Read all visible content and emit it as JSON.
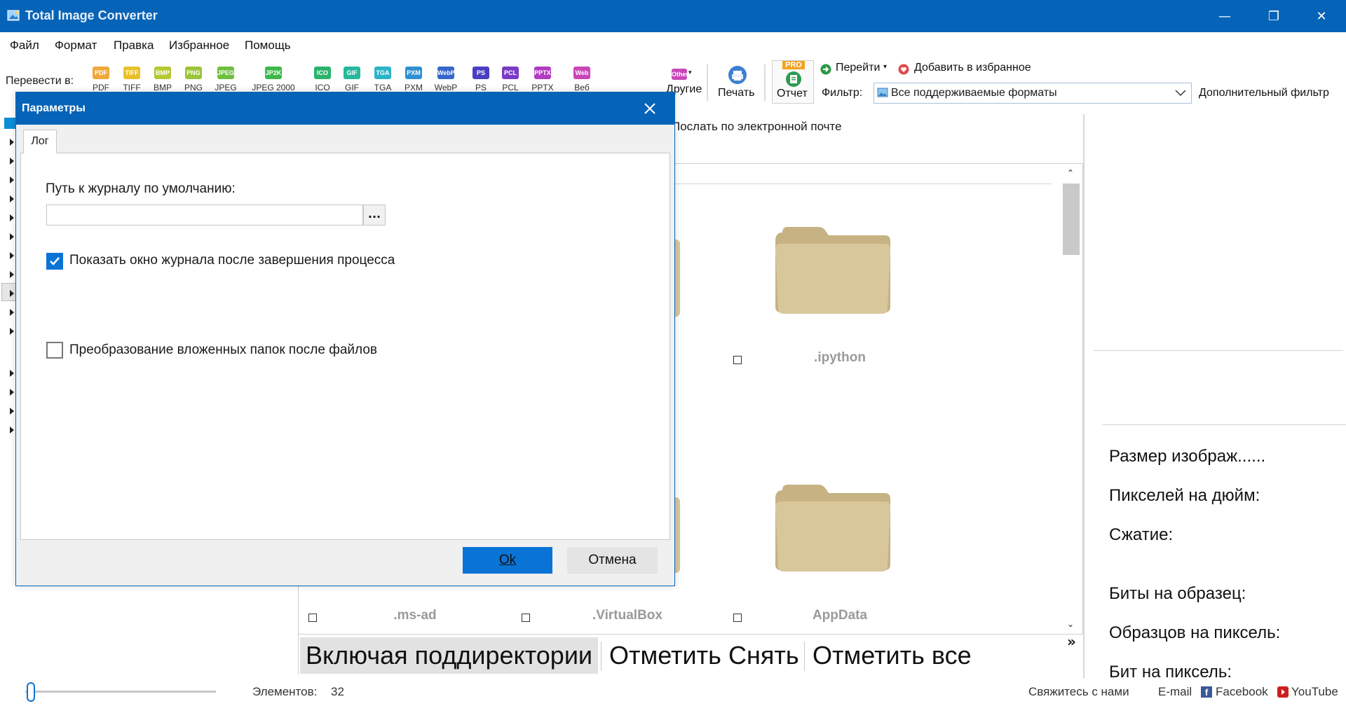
{
  "window": {
    "title": "Total Image Converter",
    "minimize_glyph": "—",
    "restore_glyph": "❐",
    "close_glyph": "✕"
  },
  "menu": [
    "Файл",
    "Формат",
    "Правка",
    "Избранное",
    "Помощь"
  ],
  "toolbar": {
    "convert_label": "Перевести в:",
    "formats": [
      {
        "icon": "PDF",
        "label": "PDF",
        "color": "#f1a83a"
      },
      {
        "icon": "TIFF",
        "label": "TIFF",
        "color": "#e8c02a"
      },
      {
        "icon": "BMP",
        "label": "BMP",
        "color": "#b5c832"
      },
      {
        "icon": "PNG",
        "label": "PNG",
        "color": "#9cc43a"
      },
      {
        "icon": "JPEG",
        "label": "JPEG",
        "color": "#6fbf3f"
      },
      {
        "icon": "JP2K",
        "label": "JPEG 2000",
        "color": "#3fb84a"
      },
      {
        "icon": "ICO",
        "label": "ICO",
        "color": "#2bb36c"
      },
      {
        "icon": "GIF",
        "label": "GIF",
        "color": "#27b79c"
      },
      {
        "icon": "TGA",
        "label": "TGA",
        "color": "#2cb3c6"
      },
      {
        "icon": "PXM",
        "label": "PXM",
        "color": "#2f8fd3"
      },
      {
        "icon": "WebP",
        "label": "WebP",
        "color": "#3566c9"
      },
      {
        "icon": "PS",
        "label": "PS",
        "color": "#4a3fc2"
      },
      {
        "icon": "PCL",
        "label": "PCL",
        "color": "#7a3bc4"
      },
      {
        "icon": "PPTX",
        "label": "PPTX",
        "color": "#b03cc0"
      },
      {
        "icon": "Web",
        "label": "Веб",
        "color": "#c946b8"
      }
    ],
    "other_icon": "Other",
    "other_label": "Другие",
    "print_label": "Печать",
    "report_label": "Отчет",
    "pro_badge": "PRO",
    "goto_label": "Перейти",
    "favorites_label": "Добавить в избранное",
    "filter_label": "Фильтр:",
    "filter_value": "Все поддерживаемые форматы",
    "extra_filter_label": "Дополнительный фильтр",
    "email_label": "Послать по электронной почте"
  },
  "files": [
    {
      "name": ".ipython"
    },
    {
      "name": ".ms-ad"
    },
    {
      "name": ".VirtualBox"
    },
    {
      "name": "AppData"
    }
  ],
  "actions": {
    "include_subdirs": "Включая поддиректории",
    "check": "Отметить",
    "uncheck": "Снять",
    "check_all": "Отметить все",
    "more_glyph": "»"
  },
  "properties": {
    "image_size": "Размер изображ......",
    "ppi": "Пикселей на дюйм:",
    "compression": "Сжатие:",
    "bits_per_sample": "Биты на образец:",
    "samples_per_pixel": "Образцов на пиксель:",
    "bits_per_pixel": "Бит на пиксель:"
  },
  "status": {
    "items_label": "Элементов:",
    "items_count": "32",
    "contact": "Свяжитесь с нами",
    "email": "E-mail",
    "facebook": "Facebook",
    "youtube": "YouTube"
  },
  "dialog": {
    "title": "Параметры",
    "tab": "Лог",
    "path_label": "Путь к журналу по умолчанию:",
    "path_value": "",
    "browse": "...",
    "show_log_label": "Показать окно журнала после завершения процесса",
    "show_log_checked": true,
    "subfolders_label": "Преобразование вложенных папок после файлов",
    "subfolders_checked": false,
    "ok": "Ok",
    "cancel": "Отмена"
  },
  "colors": {
    "titlebar": "#0563b8",
    "accent": "#0a74d6",
    "folder": "#d6c49a"
  }
}
